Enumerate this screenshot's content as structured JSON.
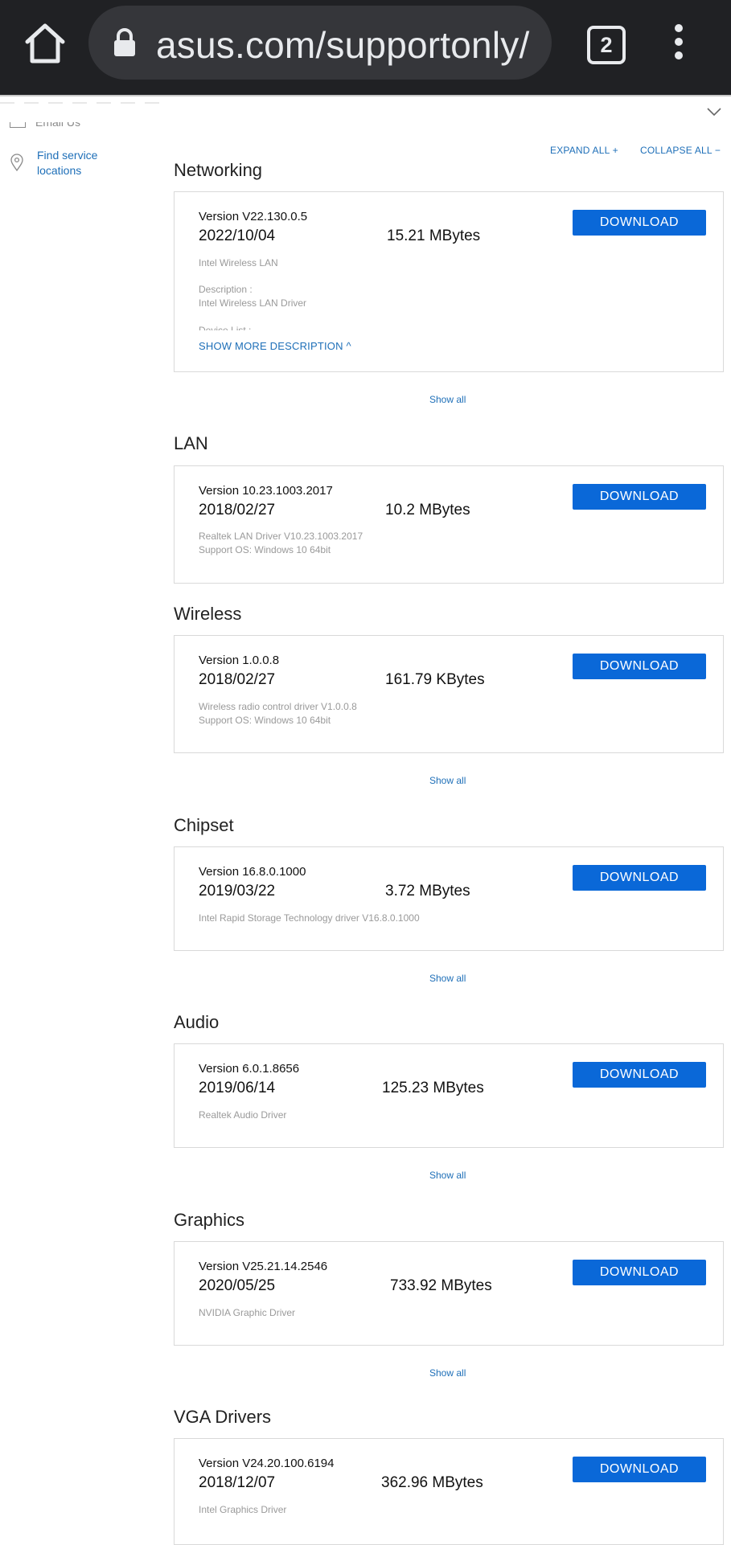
{
  "browser": {
    "url": "asus.com/supportonly/",
    "tab_count": "2"
  },
  "sidebar": {
    "cutoff_label": "Email Us",
    "find_service": "Find service locations"
  },
  "controls": {
    "expand_all": "EXPAND ALL +",
    "collapse_all": "COLLAPSE ALL −"
  },
  "show_all_label": "Show all",
  "download_label": "DOWNLOAD",
  "sections": [
    {
      "title": "Networking",
      "version": "Version V22.130.0.5",
      "date": "2022/10/04",
      "size": "15.21 MBytes",
      "desc_lines": [
        "Intel Wireless LAN"
      ],
      "extra_label": "Description :",
      "extra_text": "Intel Wireless LAN Driver",
      "clipped_label": "Device List :",
      "more_label": "SHOW MORE DESCRIPTION ^"
    },
    {
      "title": "LAN",
      "version": "Version 10.23.1003.2017",
      "date": "2018/02/27",
      "size": "10.2 MBytes",
      "desc_lines": [
        "Realtek LAN Driver V10.23.1003.2017",
        "Support OS: Windows 10 64bit"
      ]
    },
    {
      "title": "Wireless",
      "version": "Version 1.0.0.8",
      "date": "2018/02/27",
      "size": "161.79 KBytes",
      "desc_lines": [
        "Wireless radio control driver V1.0.0.8",
        "Support OS: Windows 10 64bit"
      ]
    },
    {
      "title": "Chipset",
      "version": "Version 16.8.0.1000",
      "date": "2019/03/22",
      "size": "3.72 MBytes",
      "desc_lines": [
        "Intel Rapid Storage Technology driver V16.8.0.1000"
      ]
    },
    {
      "title": "Audio",
      "version": "Version 6.0.1.8656",
      "date": "2019/06/14",
      "size": "125.23 MBytes",
      "desc_lines": [
        "Realtek Audio Driver"
      ]
    },
    {
      "title": "Graphics",
      "version": "Version V25.21.14.2546",
      "date": "2020/05/25",
      "size": "733.92 MBytes",
      "desc_lines": [
        "NVIDIA Graphic Driver"
      ]
    },
    {
      "title": "VGA Drivers",
      "version": "Version V24.20.100.6194",
      "date": "2018/12/07",
      "size": "362.96 MBytes",
      "desc_lines": [
        "Intel Graphics Driver"
      ]
    }
  ]
}
